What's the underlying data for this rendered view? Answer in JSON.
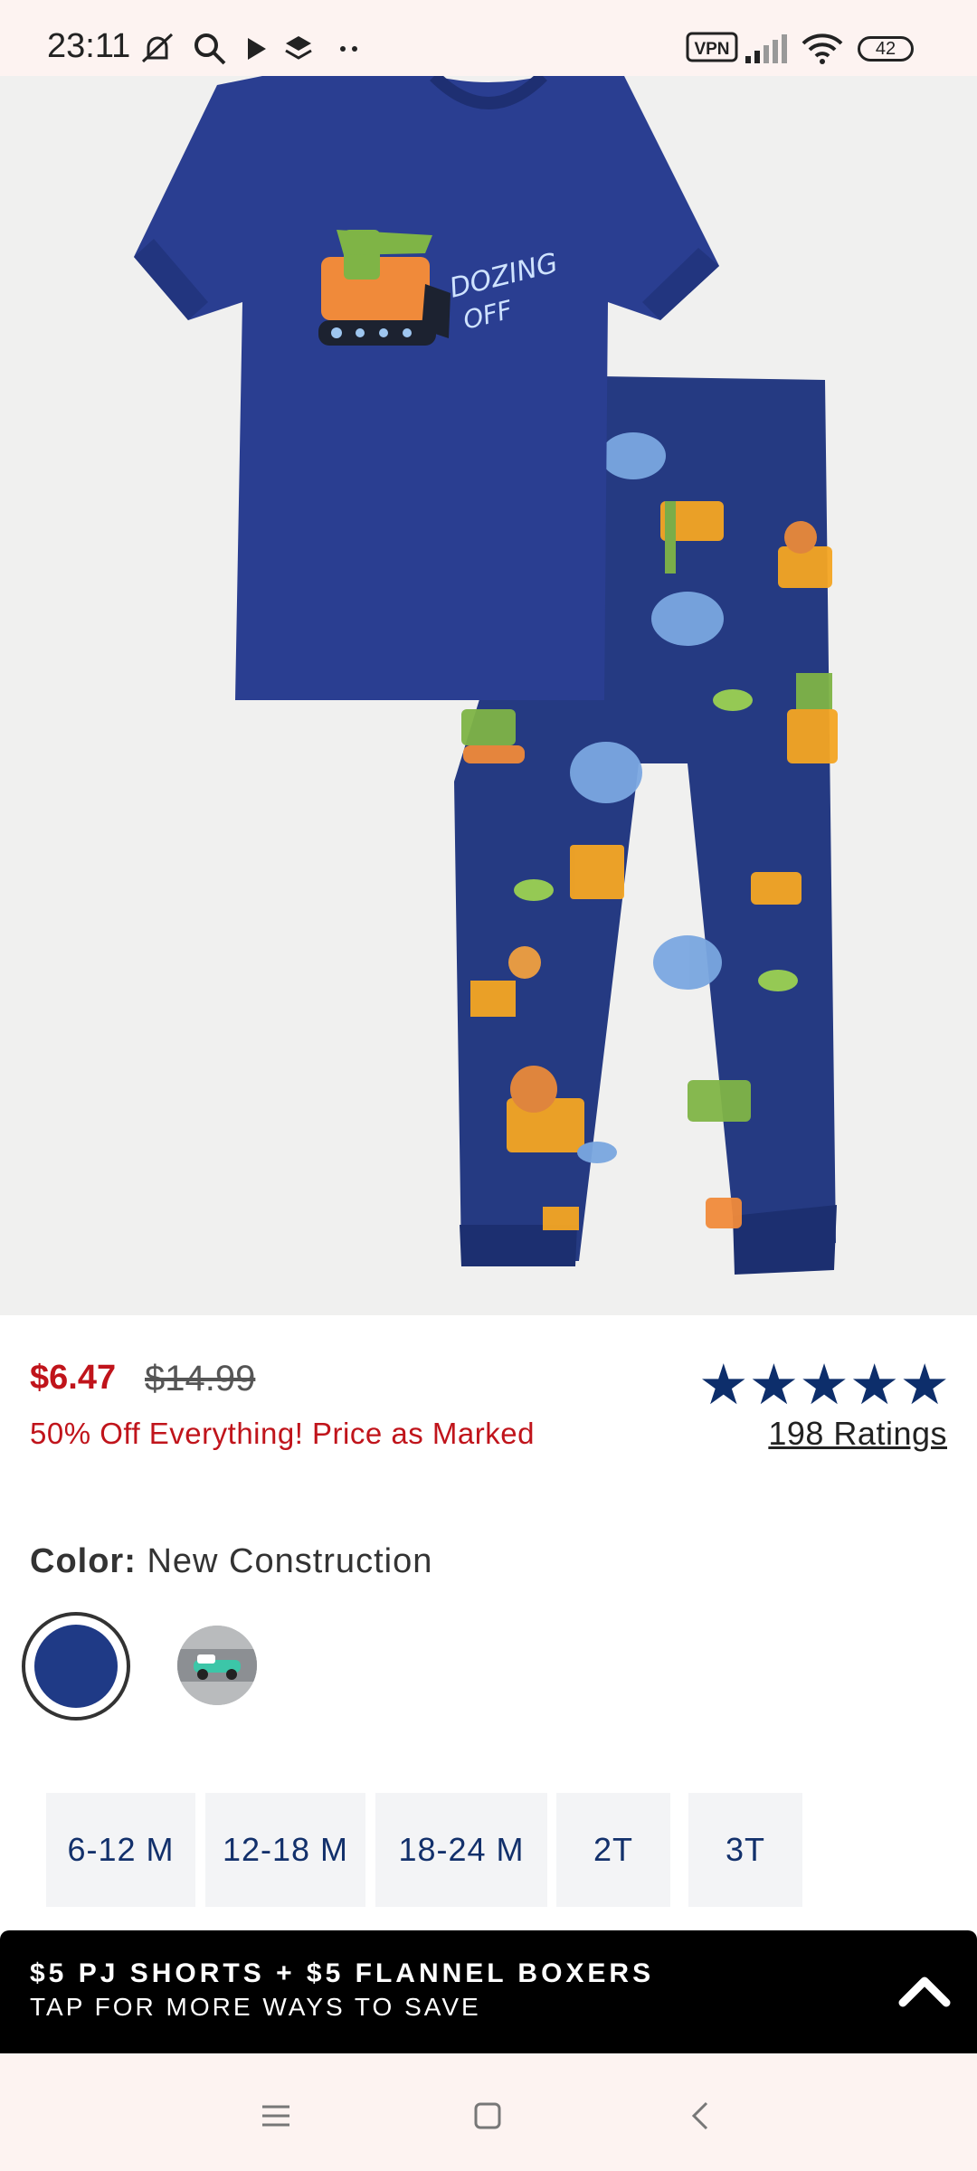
{
  "status_bar": {
    "time": "23:11",
    "vpn_label": "VPN",
    "battery": "42"
  },
  "product": {
    "carousel": {
      "total": 2,
      "active": 1
    }
  },
  "pricing": {
    "sale_price": "$6.47",
    "original_price": "$14.99",
    "promo_text": "50% Off Everything! Price as Marked"
  },
  "rating": {
    "stars": 5,
    "ratings_link": "198 Ratings"
  },
  "color": {
    "label": "Color:",
    "value": "New Construction",
    "swatches": [
      "#1f3a86",
      "#b9bbbd"
    ]
  },
  "sizes": [
    "6-12 M",
    "12-18 M",
    "18-24 M",
    "2T",
    "3T"
  ],
  "promo_banner": {
    "title": "$5 PJ SHORTS + $5 FLANNEL BOXERS",
    "subtitle": "TAP FOR MORE WAYS TO SAVE"
  },
  "colors": {
    "accent": "#0d2e6b",
    "sale": "#c0141b"
  }
}
